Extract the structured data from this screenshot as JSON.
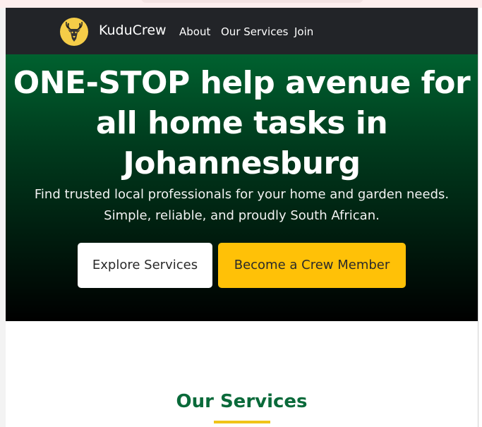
{
  "nav": {
    "brand": "KuduCrew",
    "links": [
      "About",
      "Our Services",
      "Join"
    ]
  },
  "hero": {
    "title": "ONE-STOP help avenue for all home tasks in Johannesburg",
    "subtitle": "Find trusted local professionals for your home and garden needs. Simple, reliable, and proudly South African.",
    "primary_button": "Explore Services",
    "secondary_button": "Become a Crew Member"
  },
  "services": {
    "title": "Our Services"
  },
  "icons": {
    "logo": "kudu-head-icon"
  },
  "colors": {
    "navbar": "#222428",
    "hero_top": "#00612f",
    "hero_bottom": "#000000",
    "accent_yellow": "#ffc107",
    "services_title": "#0a6a3a"
  }
}
